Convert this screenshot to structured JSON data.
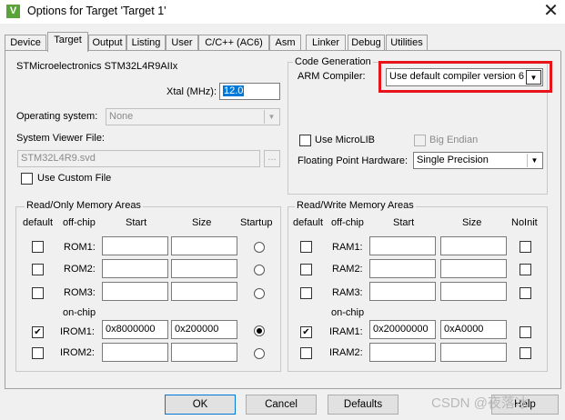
{
  "window": {
    "title": "Options for Target 'Target 1'",
    "icon": "keil-v-icon",
    "close_glyph": "✕",
    "icon_glyph": "V"
  },
  "tabs": [
    {
      "label": "Device"
    },
    {
      "label": "Target"
    },
    {
      "label": "Output"
    },
    {
      "label": "Listing"
    },
    {
      "label": "User"
    },
    {
      "label": "C/C++ (AC6)"
    },
    {
      "label": "Asm"
    },
    {
      "label": "Linker"
    },
    {
      "label": "Debug"
    },
    {
      "label": "Utilities"
    }
  ],
  "active_tab": "Target",
  "device": {
    "name": "STMicroelectronics STM32L4R9AIIx"
  },
  "xtal": {
    "label": "Xtal (MHz):",
    "value": "12.0"
  },
  "os": {
    "label": "Operating system:",
    "value": "None"
  },
  "svd": {
    "label": "System Viewer File:",
    "value": "STM32L4R9.svd",
    "browse": "..."
  },
  "custom_file": {
    "label": "Use Custom File",
    "checked": false
  },
  "codegen": {
    "title": "Code Generation",
    "compiler_label": "ARM Compiler:",
    "compiler_value": "Use default compiler version 6",
    "microlib_label": "Use MicroLIB",
    "big_endian_label": "Big Endian",
    "fpu_label": "Floating Point Hardware:",
    "fpu_value": "Single Precision"
  },
  "ro": {
    "title": "Read/Only Memory Areas",
    "headers": {
      "default": "default",
      "offchip": "off-chip",
      "start": "Start",
      "size": "Size",
      "startup": "Startup"
    },
    "onchip_label": "on-chip",
    "rows": [
      {
        "name": "ROM1:",
        "start": "",
        "size": "",
        "default": false,
        "startup": false
      },
      {
        "name": "ROM2:",
        "start": "",
        "size": "",
        "default": false,
        "startup": false
      },
      {
        "name": "ROM3:",
        "start": "",
        "size": "",
        "default": false,
        "startup": false
      },
      {
        "name": "IROM1:",
        "start": "0x8000000",
        "size": "0x200000",
        "default": true,
        "startup": true
      },
      {
        "name": "IROM2:",
        "start": "",
        "size": "",
        "default": false,
        "startup": false
      }
    ]
  },
  "rw": {
    "title": "Read/Write Memory Areas",
    "headers": {
      "default": "default",
      "offchip": "off-chip",
      "start": "Start",
      "size": "Size",
      "noinit": "NoInit"
    },
    "onchip_label": "on-chip",
    "rows": [
      {
        "name": "RAM1:",
        "start": "",
        "size": "",
        "default": false
      },
      {
        "name": "RAM2:",
        "start": "",
        "size": "",
        "default": false
      },
      {
        "name": "RAM3:",
        "start": "",
        "size": "",
        "default": false
      },
      {
        "name": "IRAM1:",
        "start": "0x20000000",
        "size": "0xA0000",
        "default": true
      },
      {
        "name": "IRAM2:",
        "start": "",
        "size": "",
        "default": false
      }
    ]
  },
  "buttons": {
    "ok": "OK",
    "cancel": "Cancel",
    "defaults": "Defaults",
    "help": "Help"
  },
  "watermark": "CSDN @夜落冰",
  "colors": {
    "highlight": "#e8141c",
    "selection": "#0078d7"
  }
}
